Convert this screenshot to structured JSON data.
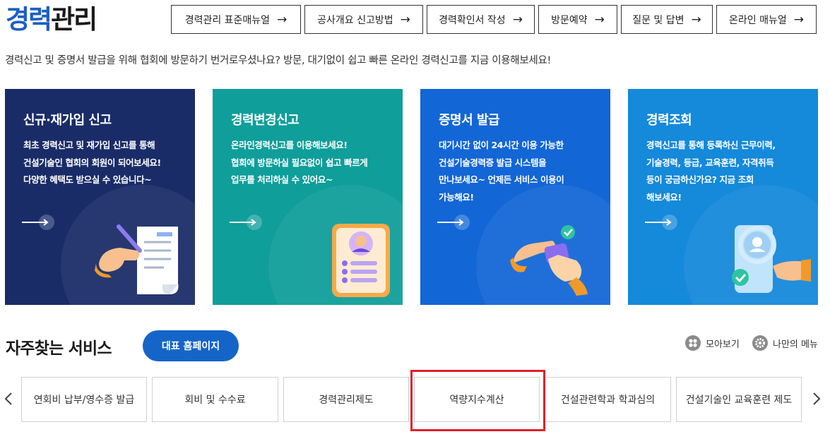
{
  "header": {
    "title_part1": "경력",
    "title_part2": "관리",
    "nav": [
      {
        "label": "경력관리 표준매뉴얼",
        "arrow": "→"
      },
      {
        "label": "공사개요 신고방법",
        "arrow": "→"
      },
      {
        "label": "경력확인서 작성",
        "arrow": "→"
      },
      {
        "label": "방문예약",
        "arrow": "→"
      },
      {
        "label": "질문 및 답변",
        "arrow": "→"
      },
      {
        "label": "온라인 매뉴얼",
        "arrow": "→"
      }
    ]
  },
  "description": "경력신고 및 증명서 발급을 위해 협회에 방문하기 번거로우셨나요? 방문, 대기없이 쉽고 빠른 온라인 경력신고를 지금 이용해보세요!",
  "cards": [
    {
      "title": "신규·재가입 신고",
      "line1": "최초 경력신고 및 재가입 신고를 통해",
      "line2": "건설기술인 협회의 회원이 되어보세요!",
      "line3": "다양한 혜택도 받으실 수 있습니다~",
      "line4": ""
    },
    {
      "title": "경력변경신고",
      "line1": "온라인경력신고를 이용해보세요!",
      "line2": "협회에 방문하실 필요없이 쉽고 빠르게",
      "line3": "업무를 처리하실 수 있어요~",
      "line4": ""
    },
    {
      "title": "증명서 발급",
      "line1": "대기시간 없이 24시간 이용 가능한",
      "line2": "건설기술경력증 발급 시스템을",
      "line3": "만나보세요~ 언제든 서비스 이용이",
      "line4": "가능해요!"
    },
    {
      "title": "경력조회",
      "line1": "경력신고를 통해 등록하신 근무이력,",
      "line2": "기술경력, 등급, 교육훈련, 자격취득",
      "line3": "등이 궁금하신가요? 지금 조회",
      "line4": "해보세요!"
    }
  ],
  "services": {
    "title": "자주찾는 서비스",
    "home_button": "대표 홈페이지",
    "view_all": "모아보기",
    "my_menu": "나만의 메뉴",
    "items": [
      "연회비 납부/영수증 발급",
      "회비 및 수수료",
      "경력관리제도",
      "역량지수계산",
      "건설관련학과 학과심의",
      "건설기술인 교육훈련 제도"
    ]
  },
  "colors": {
    "brand_blue": "#1d5fc0",
    "card1": "#1a2c68",
    "card2": "#0f9e9a",
    "card3": "#1366d6",
    "card4": "#1589da",
    "button_blue": "#1565c8",
    "highlight": "#e0202a"
  }
}
